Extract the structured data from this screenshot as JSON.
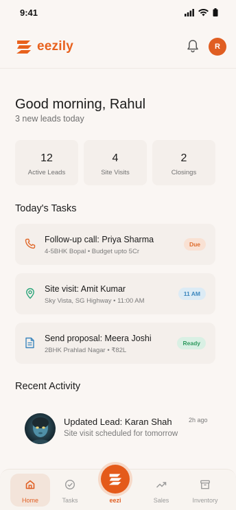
{
  "status_bar": {
    "time": "9:41"
  },
  "header": {
    "brand": "eezily",
    "avatar_initial": "R"
  },
  "greeting": {
    "title": "Good morning, Rahul",
    "subtitle": "3 new leads today"
  },
  "stats": [
    {
      "value": "12",
      "label": "Active Leads"
    },
    {
      "value": "4",
      "label": "Site Visits"
    },
    {
      "value": "2",
      "label": "Closings"
    }
  ],
  "tasks": {
    "heading": "Today's Tasks",
    "items": [
      {
        "icon": "phone-icon",
        "title": "Follow-up call: Priya Sharma",
        "subtitle": "4-5BHK Bopal • Budget upto 5Cr",
        "badge": "Due",
        "badge_bg": "#f9e1d3",
        "badge_color": "#dd6a2a"
      },
      {
        "icon": "location-pin-icon",
        "title": "Site visit: Amit Kumar",
        "subtitle": "Sky Vista, SG Highway • 11:00 AM",
        "badge": "11 AM",
        "badge_bg": "#dcebf5",
        "badge_color": "#3b86bd"
      },
      {
        "icon": "document-icon",
        "title": "Send proposal: Meera Joshi",
        "subtitle": "2BHK Prahlad Nagar • ₹82L",
        "badge": "Ready",
        "badge_bg": "#d9f0e4",
        "badge_color": "#2f9a5f"
      }
    ]
  },
  "activity": {
    "heading": "Recent Activity",
    "items": [
      {
        "title": "Updated Lead: Karan Shah",
        "subtitle": "Site visit scheduled for tomorrow",
        "time": "2h ago"
      }
    ]
  },
  "bottom_nav": {
    "items": [
      {
        "label": "Home",
        "icon": "home-icon",
        "active": true
      },
      {
        "label": "Tasks",
        "icon": "check-circle-icon",
        "active": false
      },
      {
        "label": "eezi",
        "icon": "eezily-logo-icon",
        "active": false
      },
      {
        "label": "Sales",
        "icon": "trend-up-icon",
        "active": false
      },
      {
        "label": "Inventory",
        "icon": "archive-box-icon",
        "active": false
      }
    ]
  },
  "colors": {
    "brand": "#e8611d",
    "background": "#faf6f3",
    "card": "#f4efeb"
  }
}
